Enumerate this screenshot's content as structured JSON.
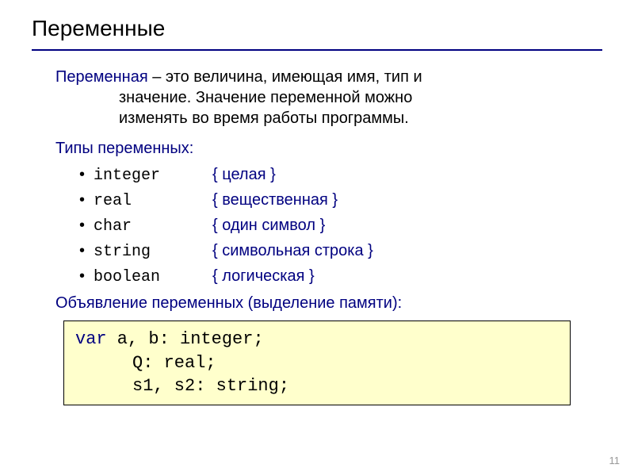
{
  "title": "Переменные",
  "definition": {
    "term": "Переменная",
    "dash": " – ",
    "text_line1": "это величина, имеющая имя, тип и",
    "text_line2": "значение. Значение переменной можно",
    "text_line3": "изменять во время работы программы."
  },
  "types_heading": "Типы переменных:",
  "types": [
    {
      "name": "integer",
      "desc": "{ целая }"
    },
    {
      "name": "real",
      "desc": "{ вещественная }"
    },
    {
      "name": "char",
      "desc": "{ один символ }"
    },
    {
      "name": "string",
      "desc": "{ символьная строка }"
    },
    {
      "name": "boolean",
      "desc": "{ логическая }"
    }
  ],
  "decl_heading": "Объявление переменных (выделение памяти):",
  "code": {
    "kw": "var",
    "line1_rest": "  a, b: integer;",
    "line2": "Q: real;",
    "line3": "s1, s2: string;"
  },
  "page_number": "11"
}
